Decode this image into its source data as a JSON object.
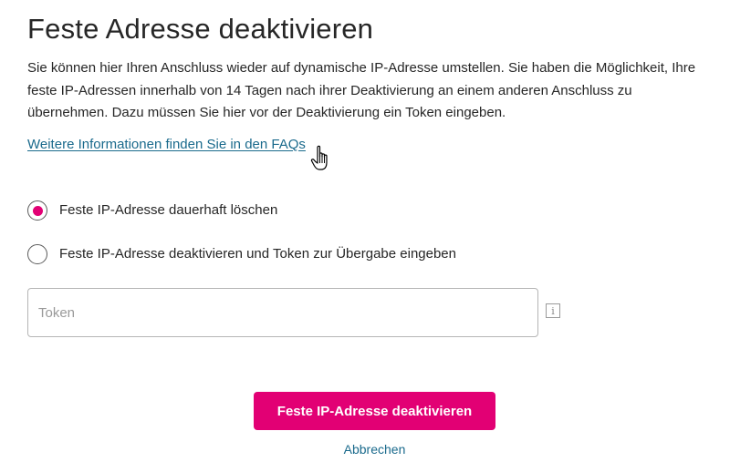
{
  "page": {
    "title": "Feste Adresse deaktivieren",
    "description": "Sie können hier Ihren Anschluss wieder auf dynamische IP-Adresse umstellen. Sie haben die Möglichkeit, Ihre feste IP-Adressen innerhalb von 14 Tagen nach ihrer Deaktivierung an einem anderen Anschluss zu übernehmen. Dazu müssen Sie hier vor der Deaktivierung ein Token eingeben.",
    "faq_link": "Weitere Informationen finden Sie in den FAQs"
  },
  "options": [
    {
      "label": "Feste IP-Adresse dauerhaft löschen",
      "selected": true
    },
    {
      "label": "Feste IP-Adresse deaktivieren und Token zur Übergabe eingeben",
      "selected": false
    }
  ],
  "token": {
    "placeholder": "Token",
    "value": "",
    "info_icon": "i"
  },
  "actions": {
    "submit_label": "Feste IP-Adresse deaktivieren",
    "cancel_label": "Abbrechen"
  },
  "colors": {
    "accent": "#e20074",
    "link": "#1a6a8c",
    "text": "#262626"
  },
  "icons": {
    "cursor": "hand-pointer-cursor-icon",
    "info": "info-icon"
  }
}
